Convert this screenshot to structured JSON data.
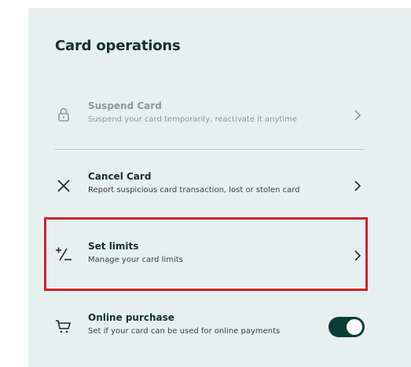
{
  "title": "Card operations",
  "operations": [
    {
      "label": "Suspend Card",
      "description": "Suspend your card temporarily, reactivate it anytime",
      "icon": "lock-icon",
      "state": "disabled"
    },
    {
      "label": "Cancel Card",
      "description": "Report suspicious card transaction, lost or stolen card",
      "icon": "close-icon"
    },
    {
      "label": "Set limits",
      "description": "Manage your card limits",
      "icon": "plus-minus-icon",
      "highlighted": true
    },
    {
      "label": "Online purchase",
      "description": "Set if your card can be used for online payments",
      "icon": "cart-icon",
      "toggle_on": true
    }
  ],
  "colors": {
    "panel_background": "#e6f0ef",
    "text_primary": "#16302c",
    "text_disabled": "#8b9a96",
    "toggle_on": "#0c3d34",
    "highlight_border": "#d2232a"
  }
}
